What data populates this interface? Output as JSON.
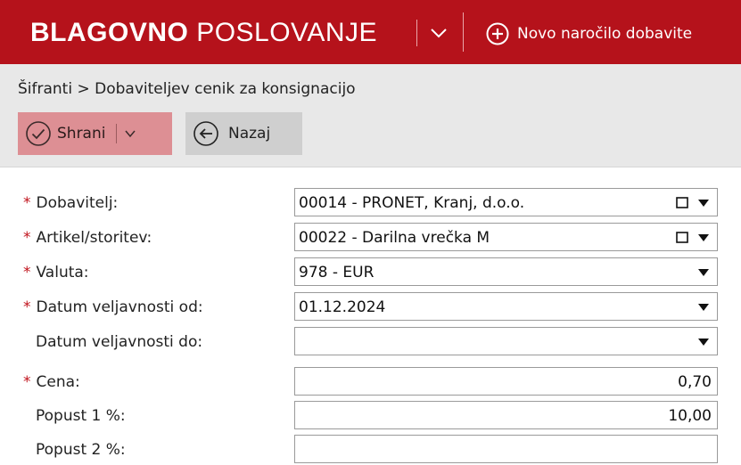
{
  "app": {
    "title_bold": "BLAGOVNO",
    "title_light": "POSLOVANJE",
    "new_order_label": "Novo naročilo dobavite"
  },
  "breadcrumb": "Šifranti > Dobaviteljev cenik za konsignacijo",
  "toolbar": {
    "save_label": "Shrani",
    "back_label": "Nazaj"
  },
  "form": {
    "required_marker": "*",
    "fields": [
      {
        "label": "Dobavitelj:",
        "required": true,
        "value": "00014 - PRONET, Kranj, d.o.o.",
        "lookup": true,
        "dropdown": true
      },
      {
        "label": "Artikel/storitev:",
        "required": true,
        "value": "00022 - Darilna vrečka M",
        "lookup": true,
        "dropdown": true
      },
      {
        "label": "Valuta:",
        "required": true,
        "value": "978 - EUR",
        "lookup": false,
        "dropdown": true
      },
      {
        "label": "Datum veljavnosti od:",
        "required": true,
        "value": "01.12.2024",
        "lookup": false,
        "dropdown": true
      },
      {
        "label": "Datum veljavnosti do:",
        "required": false,
        "value": "",
        "lookup": false,
        "dropdown": true
      },
      {
        "label": "Cena:",
        "required": true,
        "value": "0,70",
        "lookup": false,
        "dropdown": false
      },
      {
        "label": "Popust 1 %:",
        "required": false,
        "value": "10,00",
        "lookup": false,
        "dropdown": false
      },
      {
        "label": "Popust 2 %:",
        "required": false,
        "value": "",
        "lookup": false,
        "dropdown": false
      }
    ]
  },
  "colors": {
    "brand_red": "#b5121b",
    "save_button_bg": "#dd8f94",
    "toolbar_bg": "#e8e8e8",
    "required_red": "#c0121b"
  },
  "icons": {
    "chevron": "chevron-down-icon",
    "add": "plus-circle-icon",
    "save": "check-circle-icon",
    "back": "arrow-left-circle-icon",
    "lookup": "lookup-square-icon",
    "dropdown": "dropdown-arrow-icon"
  }
}
